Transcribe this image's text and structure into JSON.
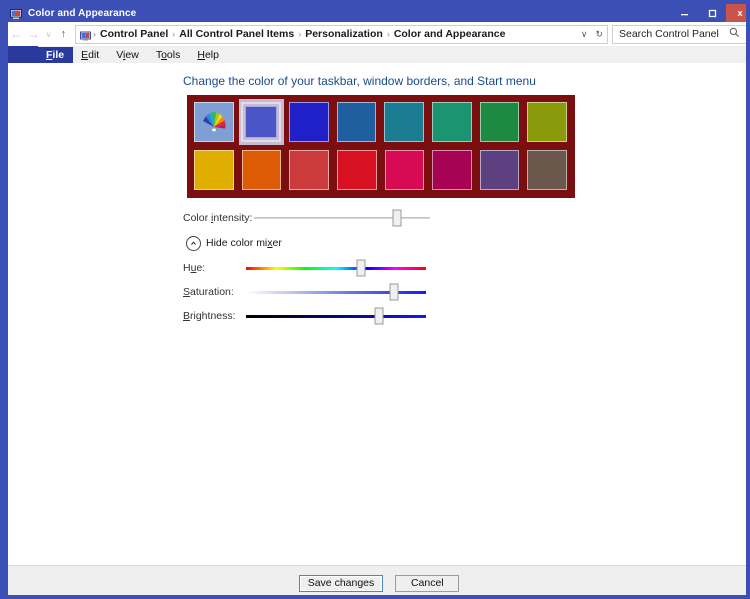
{
  "window": {
    "title": "Color and Appearance",
    "icon": "display-settings-icon",
    "controls": {
      "minimize": "–",
      "maximize": "□",
      "close": "x"
    }
  },
  "addressbar": {
    "back": "←",
    "forward": "→",
    "history_chevron": "∨",
    "up": "↑",
    "crumbs": [
      "Control Panel",
      "All Control Panel Items",
      "Personalization",
      "Color and Appearance"
    ],
    "separator": "›",
    "dropdown_chevron": "∨",
    "refresh": "↻"
  },
  "search": {
    "placeholder": "Search Control Panel",
    "icon": "search-icon"
  },
  "menubar": {
    "items": [
      {
        "label": "File",
        "accel": "F",
        "selected": true
      },
      {
        "label": "Edit",
        "accel": "E",
        "selected": false
      },
      {
        "label": "View",
        "accel": "V",
        "selected": false
      },
      {
        "label": "Tools",
        "accel": "T",
        "selected": false
      },
      {
        "label": "Help",
        "accel": "H",
        "selected": false
      }
    ]
  },
  "main": {
    "heading": "Change the color of your taskbar, window borders, and Start menu",
    "panel_background": "#7b0f0f",
    "swatches": [
      [
        {
          "name": "custom-color-picker",
          "color": "#7f9fd4",
          "icon": "color-fan-icon",
          "selected": false
        },
        {
          "name": "indigo-blue",
          "color": "#4a55c8",
          "selected": true
        },
        {
          "name": "royal-blue",
          "color": "#2020c8",
          "selected": false
        },
        {
          "name": "steel-blue",
          "color": "#1f5fa0",
          "selected": false
        },
        {
          "name": "teal-blue",
          "color": "#1c7d92",
          "selected": false
        },
        {
          "name": "sea-green",
          "color": "#1a9471",
          "selected": false
        },
        {
          "name": "emerald-green",
          "color": "#1d8a42",
          "selected": false
        },
        {
          "name": "olive-green",
          "color": "#8a9a0a",
          "selected": false
        }
      ],
      [
        {
          "name": "gold-yellow",
          "color": "#dfae00",
          "selected": false
        },
        {
          "name": "pumpkin-orange",
          "color": "#de5b06",
          "selected": false
        },
        {
          "name": "brick-red",
          "color": "#cc3b3b",
          "selected": false
        },
        {
          "name": "crimson-red",
          "color": "#d81122",
          "selected": false
        },
        {
          "name": "rose-pink",
          "color": "#d60b54",
          "selected": false
        },
        {
          "name": "magenta-purple",
          "color": "#a70354",
          "selected": false
        },
        {
          "name": "violet-purple",
          "color": "#5c4080",
          "selected": false
        },
        {
          "name": "taupe-brown",
          "color": "#6b584c",
          "selected": false
        }
      ]
    ],
    "sliders": [
      {
        "name": "color-intensity",
        "label": "Color intensity:",
        "accel": "i",
        "type": "plain",
        "value_pct": 81
      },
      {
        "name": "hue",
        "label": "Hue:",
        "accel": "u",
        "type": "hue",
        "value_pct": 64
      },
      {
        "name": "saturation",
        "label": "Saturation:",
        "accel": "S",
        "type": "saturation",
        "value_pct": 82
      },
      {
        "name": "brightness",
        "label": "Brightness:",
        "accel": "B",
        "type": "brightness",
        "value_pct": 74
      }
    ],
    "mixer_toggle": {
      "label": "Hide color mixer",
      "accel": "x",
      "icon": "chevron-up-circle-icon",
      "expanded": true
    }
  },
  "footer": {
    "save_label": "Save changes",
    "cancel_label": "Cancel"
  }
}
